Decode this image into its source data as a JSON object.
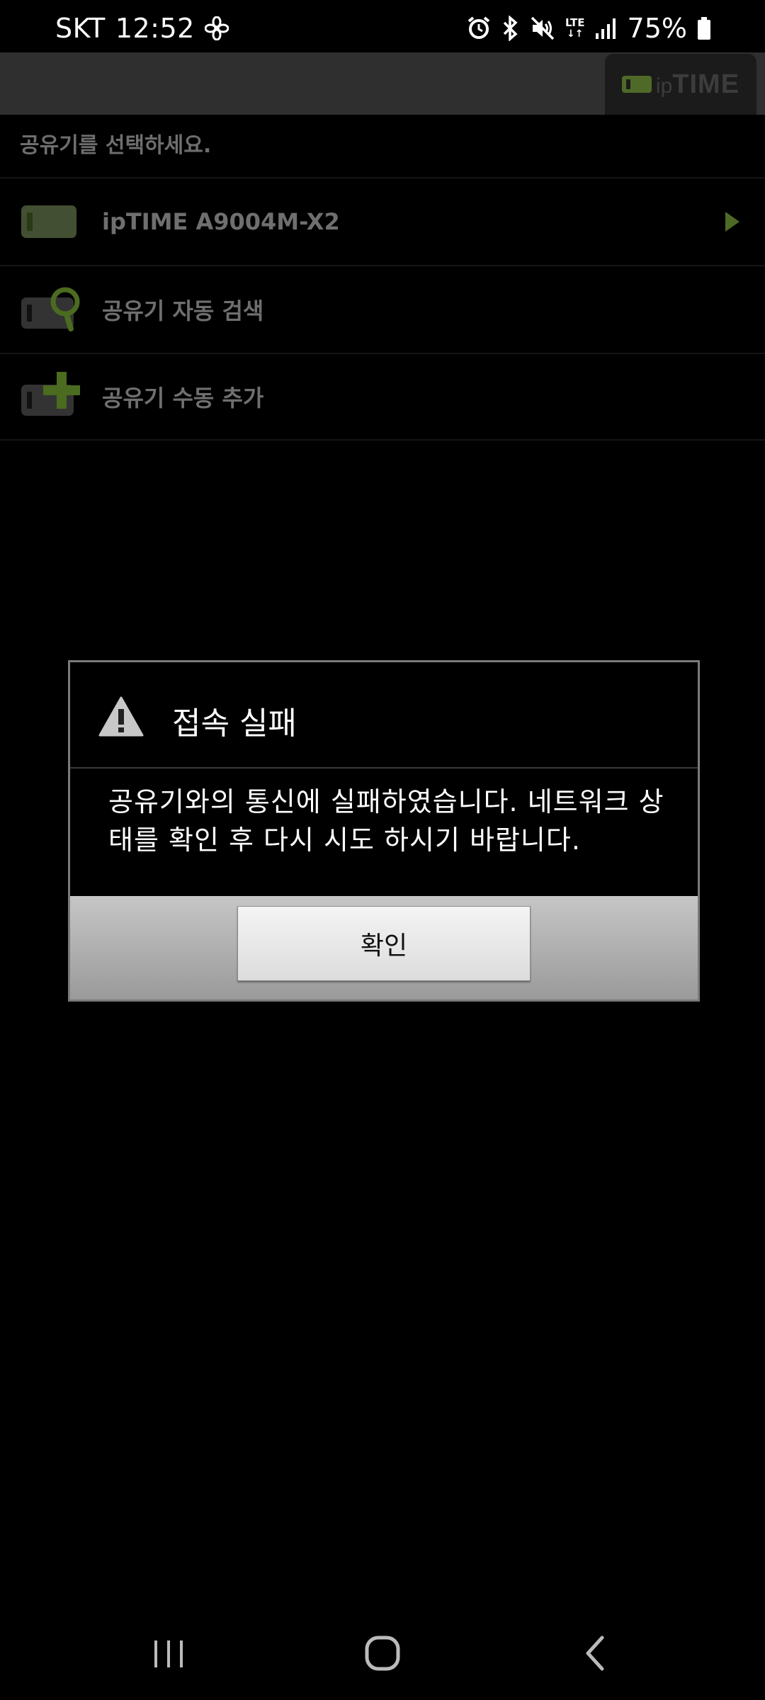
{
  "status_bar": {
    "carrier": "SKT",
    "time": "12:52",
    "network": "LTE",
    "battery": "75%",
    "icons": [
      "fan-icon",
      "alarm-icon",
      "bluetooth-icon",
      "mute-icon",
      "lte-icon",
      "signal-icon",
      "battery-icon"
    ]
  },
  "header": {
    "logo_ip": "ip",
    "logo_time": "TIME",
    "accent_color": "#4f6a28"
  },
  "router_list": {
    "prompt": "공유기를 선택하세요.",
    "items": [
      {
        "label": "ipTIME A9004M-X2",
        "icon": "router-icon"
      },
      {
        "label": "공유기 자동 검색",
        "icon": "router-search-icon"
      },
      {
        "label": "공유기 수동 추가",
        "icon": "router-add-icon"
      }
    ]
  },
  "dialog": {
    "title": "접속 실패",
    "message": "공유기와의 통신에 실패하였습니다. 네트워크 상태를 확인 후 다시 시도 하시기 바랍니다.",
    "confirm_label": "확인"
  },
  "nav_bar": {
    "buttons": [
      "recents-icon",
      "home-icon",
      "back-icon"
    ]
  }
}
